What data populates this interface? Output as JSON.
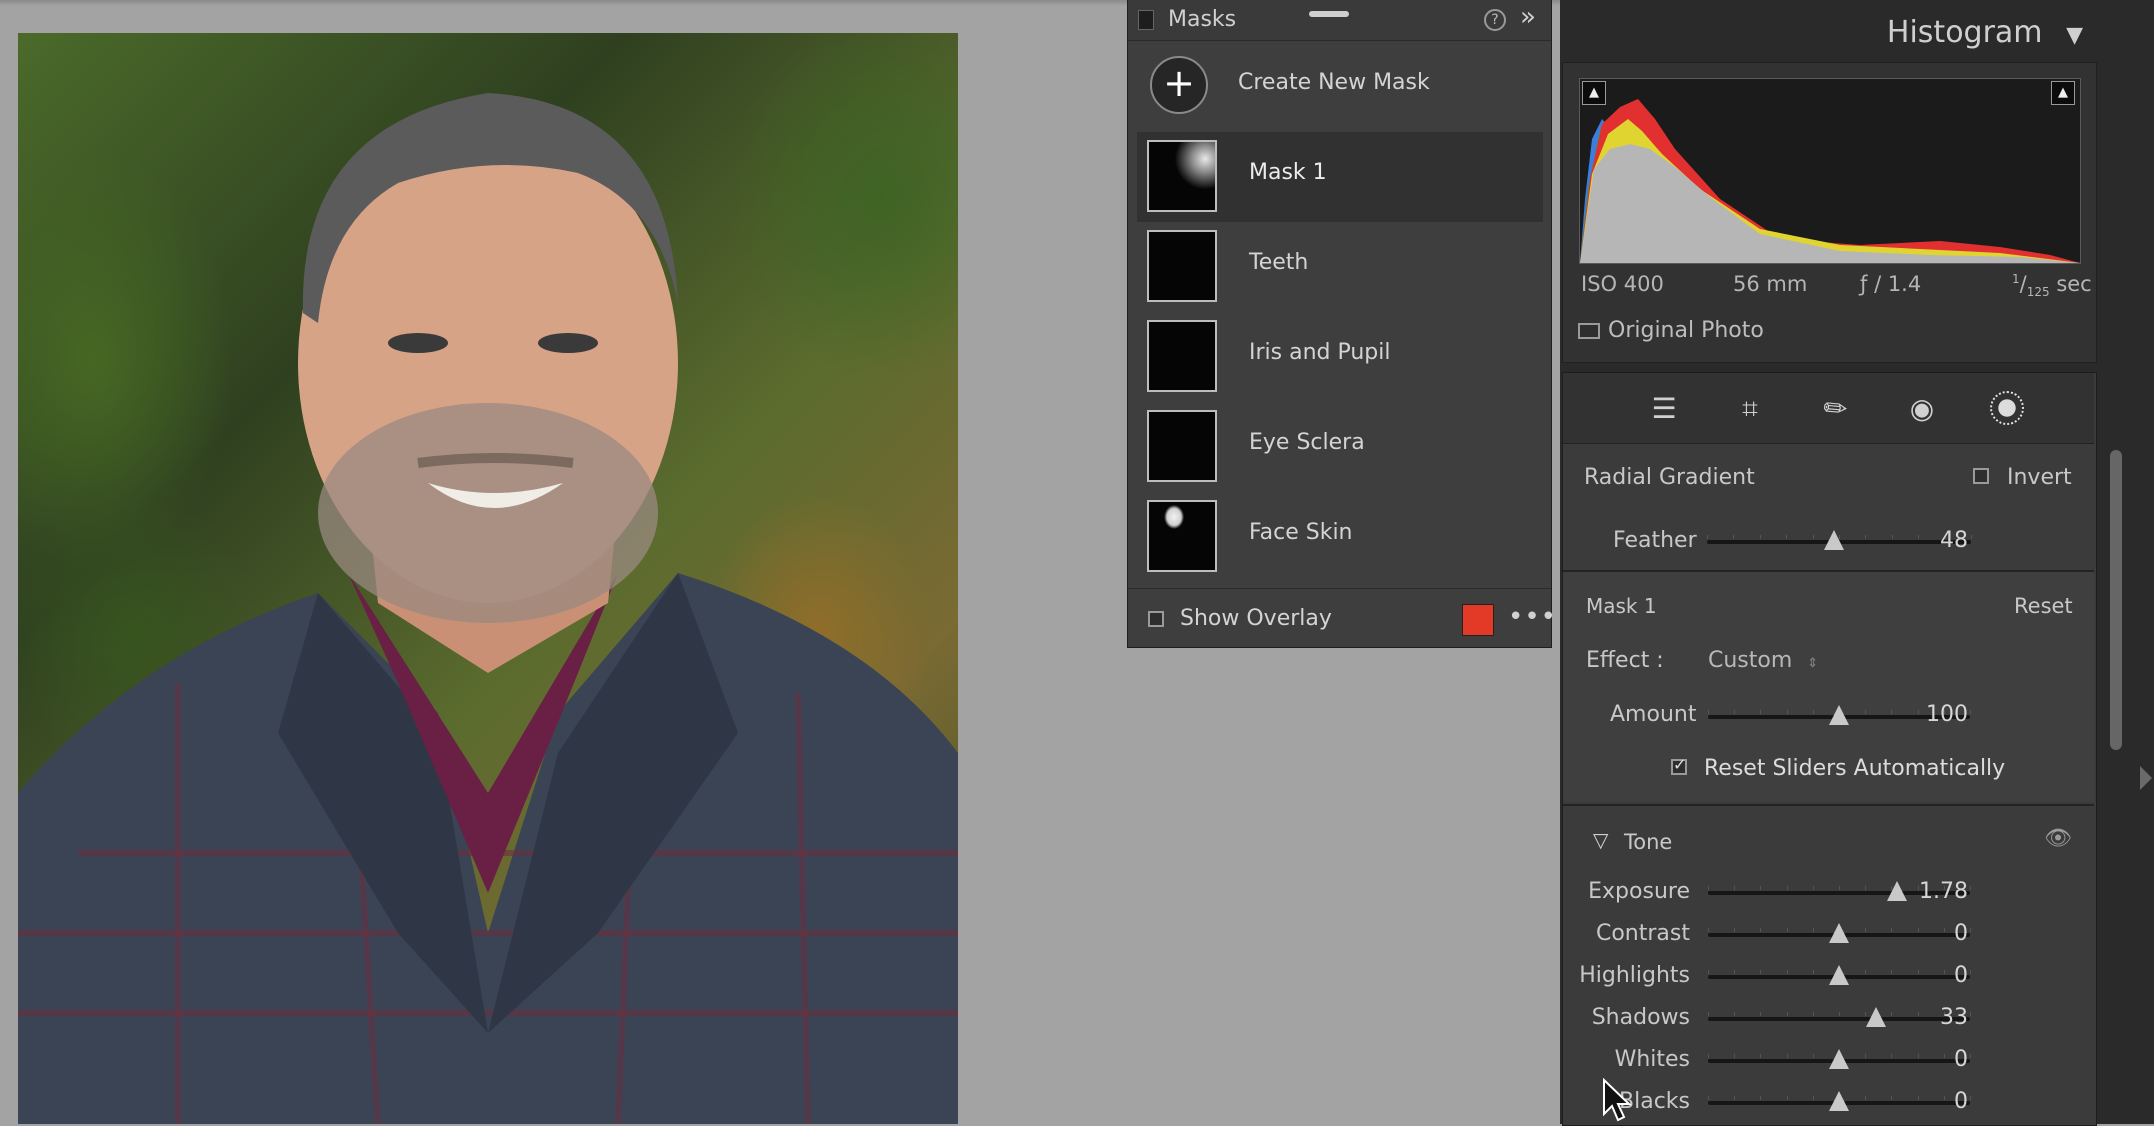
{
  "masks_panel": {
    "title": "Masks",
    "create_label": "Create New Mask",
    "items": [
      {
        "label": "Mask 1",
        "selected": true
      },
      {
        "label": "Teeth",
        "selected": false
      },
      {
        "label": "Iris and Pupil",
        "selected": false
      },
      {
        "label": "Eye Sclera",
        "selected": false
      },
      {
        "label": "Face Skin",
        "selected": false
      }
    ],
    "show_overlay_label": "Show Overlay",
    "overlay_color": "#e23a26"
  },
  "histogram": {
    "title": "Histogram",
    "iso": "ISO 400",
    "focal": "56 mm",
    "aperture": "ƒ / 1.4",
    "shutter_num": "1",
    "shutter_den": "125",
    "shutter_unit": "sec",
    "original_photo_label": "Original Photo"
  },
  "radial": {
    "title": "Radial Gradient",
    "invert_label": "Invert",
    "feather_label": "Feather",
    "feather_value": "48",
    "feather_level": 0.48
  },
  "mask_settings": {
    "title": "Mask 1",
    "reset_label": "Reset",
    "effect_label": "Effect :",
    "effect_value": "Custom",
    "amount_label": "Amount",
    "amount_value": "100",
    "amount_level": 0.5,
    "reset_sliders_label": "Reset Sliders Automatically"
  },
  "tone": {
    "title": "Tone",
    "sliders": [
      {
        "label": "Exposure",
        "value": "1.78",
        "level": 0.72
      },
      {
        "label": "Contrast",
        "value": "0",
        "level": 0.5
      },
      {
        "label": "Highlights",
        "value": "0",
        "level": 0.5
      },
      {
        "label": "Shadows",
        "value": "33",
        "level": 0.64
      },
      {
        "label": "Whites",
        "value": "0",
        "level": 0.5
      },
      {
        "label": "Blacks",
        "value": "0",
        "level": 0.5
      }
    ]
  },
  "icons": [
    "plus-icon",
    "help-icon",
    "collapse-icon",
    "more-icon",
    "sliders-icon",
    "crop-icon",
    "healing-icon",
    "redeye-icon",
    "masking-icon",
    "eye-icon"
  ]
}
